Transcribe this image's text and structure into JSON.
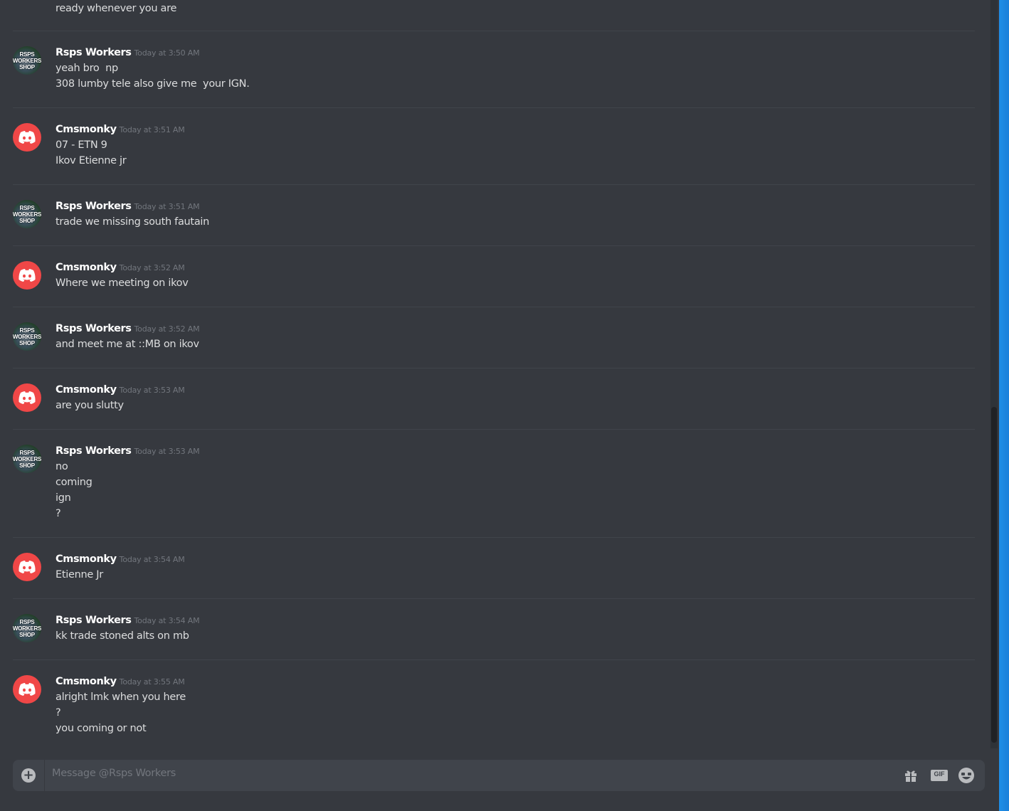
{
  "top_message_line": "ready whenever you are",
  "messages": [
    {
      "author": "Rsps Workers",
      "time": "Today at 3:50 AM",
      "avatar": "rsps-workers-shop-logo",
      "lines": [
        "yeah bro  np",
        "308 lumby tele also give me  your IGN."
      ]
    },
    {
      "author": "Cmsmonky",
      "time": "Today at 3:51 AM",
      "avatar": "discord-default-avatar",
      "lines": [
        "07 - ETN 9",
        "Ikov Etienne jr"
      ]
    },
    {
      "author": "Rsps Workers",
      "time": "Today at 3:51 AM",
      "avatar": "rsps-workers-shop-logo",
      "lines": [
        "trade we missing south fautain"
      ]
    },
    {
      "author": "Cmsmonky",
      "time": "Today at 3:52 AM",
      "avatar": "discord-default-avatar",
      "lines": [
        "Where we meeting on ikov"
      ]
    },
    {
      "author": "Rsps Workers",
      "time": "Today at 3:52 AM",
      "avatar": "rsps-workers-shop-logo",
      "lines": [
        "and meet me at ::MB on ikov"
      ]
    },
    {
      "author": "Cmsmonky",
      "time": "Today at 3:53 AM",
      "avatar": "discord-default-avatar",
      "lines": [
        "are you slutty"
      ]
    },
    {
      "author": "Rsps Workers",
      "time": "Today at 3:53 AM",
      "avatar": "rsps-workers-shop-logo",
      "lines": [
        "no",
        "coming",
        "ign",
        "?"
      ]
    },
    {
      "author": "Cmsmonky",
      "time": "Today at 3:54 AM",
      "avatar": "discord-default-avatar",
      "lines": [
        "Etienne Jr"
      ]
    },
    {
      "author": "Rsps Workers",
      "time": "Today at 3:54 AM",
      "avatar": "rsps-workers-shop-logo",
      "lines": [
        "kk trade stoned alts on mb"
      ]
    },
    {
      "author": "Cmsmonky",
      "time": "Today at 3:55 AM",
      "avatar": "discord-default-avatar",
      "lines": [
        "alright lmk when you here",
        "?",
        "you coming or not"
      ]
    }
  ],
  "rsps_logo_text": [
    "RSPS",
    "WORKERS",
    "SHOP"
  ],
  "composer": {
    "placeholder": "Message @Rsps Workers",
    "add_icon": "plus-circle-icon",
    "gift_icon": "gift-icon",
    "gif_label": "GIF",
    "emoji_icon": "emoji-icon"
  },
  "colors": {
    "background": "#36393f",
    "divider": "#40444b",
    "username": "#ffffff",
    "message_text": "#dcddde",
    "timestamp": "#72767d",
    "discord_avatar": "#f04747",
    "composer_bg": "#40444b"
  }
}
